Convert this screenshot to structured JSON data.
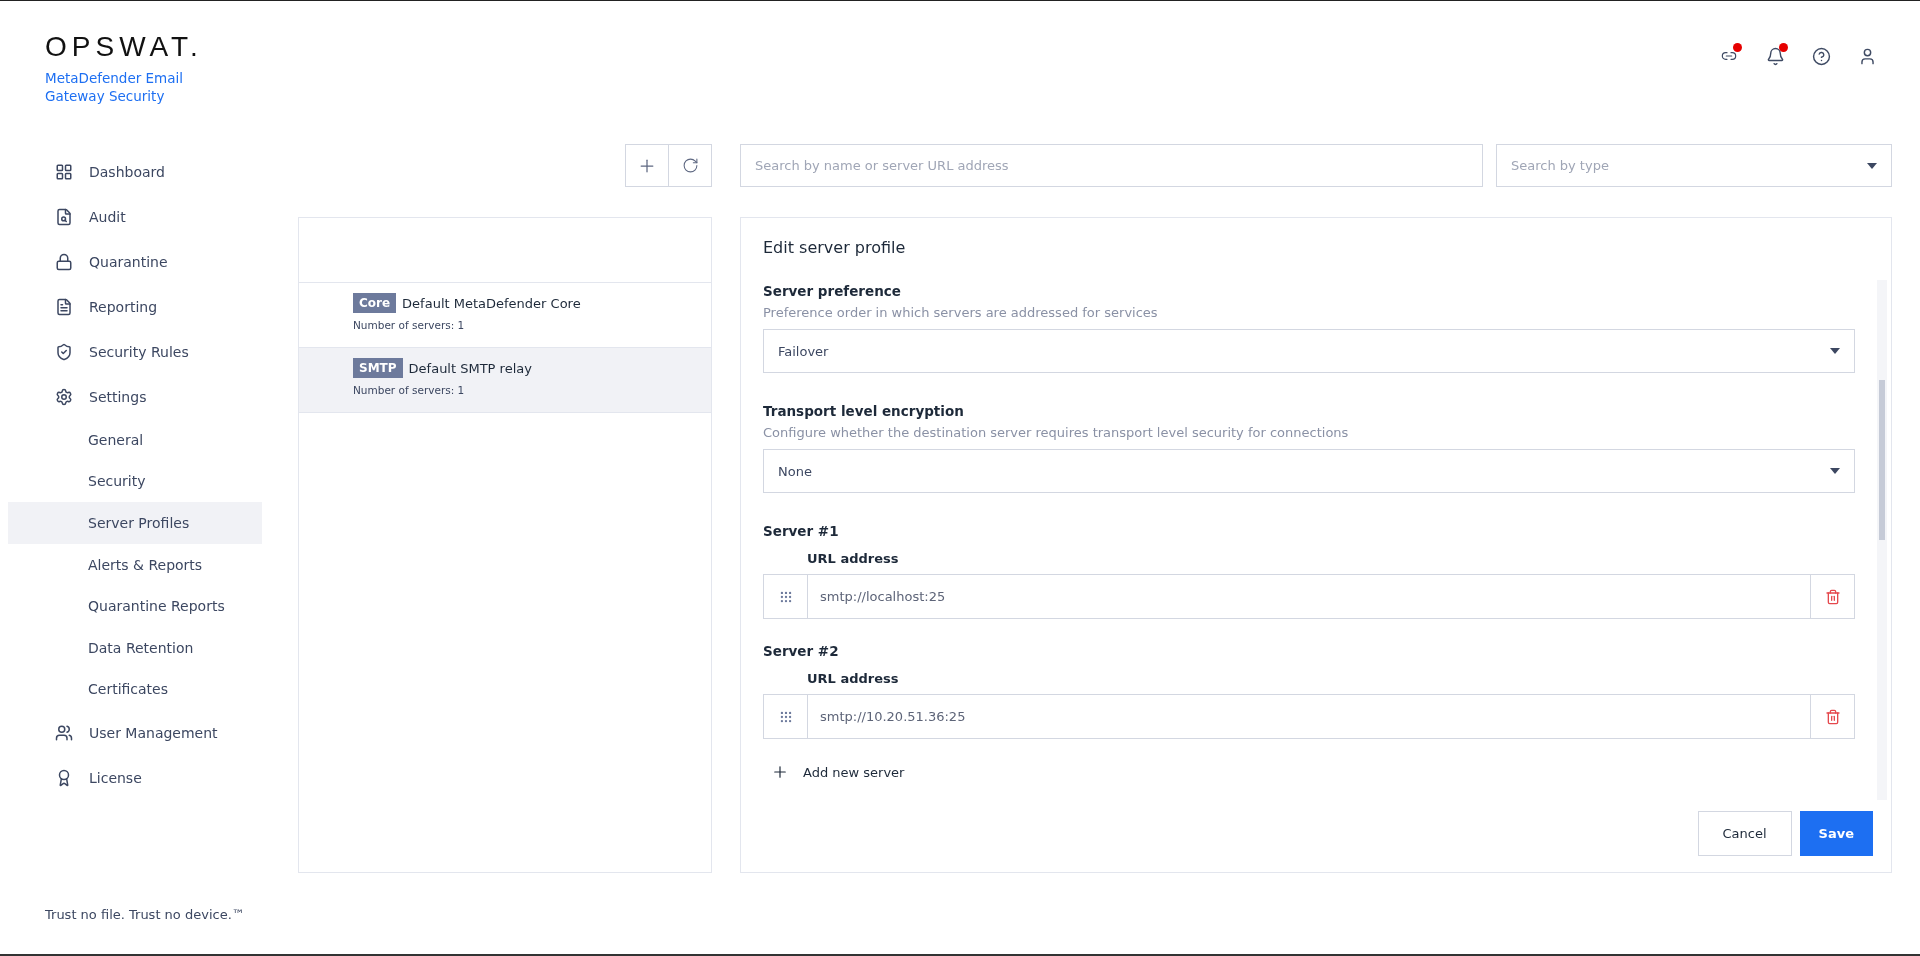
{
  "brand": {
    "logo": "OPSWAT.",
    "product": "MetaDefender Email Gateway Security"
  },
  "header_icons": [
    {
      "alert": true
    },
    {
      "alert": true
    },
    {
      "alert": false
    },
    {
      "alert": false
    }
  ],
  "sidebar": {
    "items": [
      {
        "label": "Dashboard",
        "selected": false
      },
      {
        "label": "Audit",
        "selected": false
      },
      {
        "label": "Quarantine",
        "selected": false
      },
      {
        "label": "Reporting",
        "selected": false
      },
      {
        "label": "Security Rules",
        "selected": false
      },
      {
        "label": "Settings",
        "selected": false,
        "children": [
          {
            "label": "General",
            "selected": false
          },
          {
            "label": "Security",
            "selected": false
          },
          {
            "label": "Server Profiles",
            "selected": true
          },
          {
            "label": "Alerts & Reports",
            "selected": false
          },
          {
            "label": "Quarantine Reports",
            "selected": false
          },
          {
            "label": "Data Retention",
            "selected": false
          },
          {
            "label": "Certificates",
            "selected": false
          }
        ]
      },
      {
        "label": "User Management",
        "selected": false
      },
      {
        "label": "License",
        "selected": false
      }
    ],
    "footer": "Trust no file. Trust no device.™"
  },
  "search": {
    "placeholder": "Search by name or server URL address"
  },
  "type_filter": {
    "placeholder": "Search by type"
  },
  "profiles": [
    {
      "tag": "Core",
      "name": "Default MetaDefender Core",
      "detail": "Number of servers: 1",
      "selected": false
    },
    {
      "tag": "SMTP",
      "name": "Default SMTP relay",
      "detail": "Number of servers: 1",
      "selected": true
    }
  ],
  "editor": {
    "title": "Edit server profile",
    "fields": [
      {
        "label": "Server preference",
        "hint": "Preference order in which servers are addressed for services",
        "value": "Failover"
      },
      {
        "label": "Transport level encryption",
        "hint": "Configure whether the destination server requires transport level security for connections",
        "value": "None"
      }
    ],
    "servers": [
      {
        "title": "Server #1",
        "label": "URL address",
        "value": "smtp://localhost:25"
      },
      {
        "title": "Server #2",
        "label": "URL address",
        "value": "smtp://10.20.51.36:25"
      }
    ],
    "add_label": "Add new server",
    "buttons": [
      {
        "label": "Cancel",
        "kind": "secondary"
      },
      {
        "label": "Save",
        "kind": "primary"
      }
    ]
  }
}
